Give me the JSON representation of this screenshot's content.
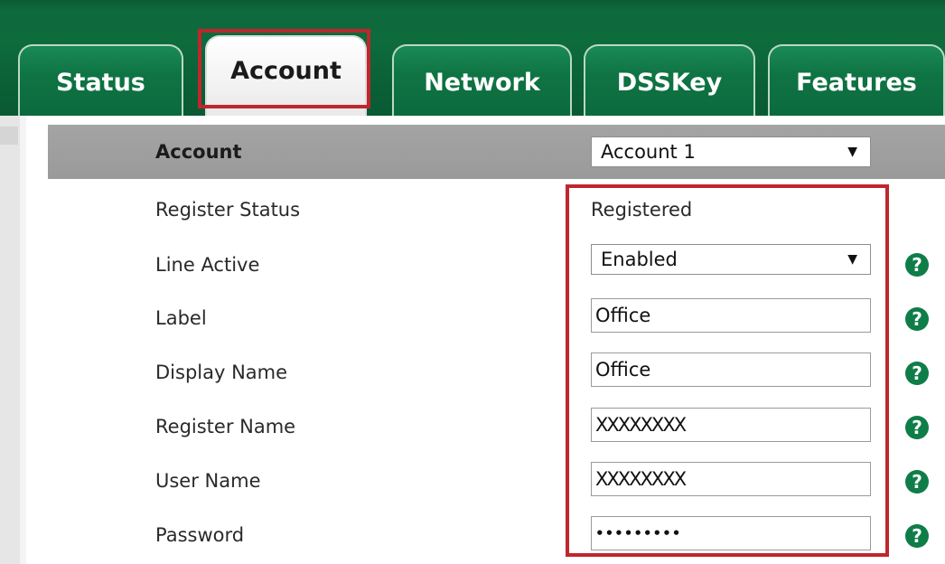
{
  "tabs": [
    {
      "label": "Status",
      "active": false
    },
    {
      "label": "Account",
      "active": true
    },
    {
      "label": "Network",
      "active": false
    },
    {
      "label": "DSSKey",
      "active": false
    },
    {
      "label": "Features",
      "active": false
    }
  ],
  "header": {
    "label": "Account",
    "selected": "Account 1"
  },
  "fields": {
    "register_status": {
      "label": "Register Status",
      "value": "Registered"
    },
    "line_active": {
      "label": "Line Active",
      "value": "Enabled"
    },
    "label": {
      "label": "Label",
      "value": "Office"
    },
    "display_name": {
      "label": "Display Name",
      "value": "Office"
    },
    "register_name": {
      "label": "Register Name",
      "value": "XXXXXXXX"
    },
    "user_name": {
      "label": "User Name",
      "value": "XXXXXXXX"
    },
    "password": {
      "label": "Password",
      "value": "•••••••••"
    }
  },
  "help_glyph": "?",
  "dropdown_glyph": "▼",
  "colors": {
    "tab_green": "#0f7444",
    "highlight_red": "#c0262e",
    "header_gray": "#9e9e9e",
    "help_green": "#0f7d47"
  }
}
